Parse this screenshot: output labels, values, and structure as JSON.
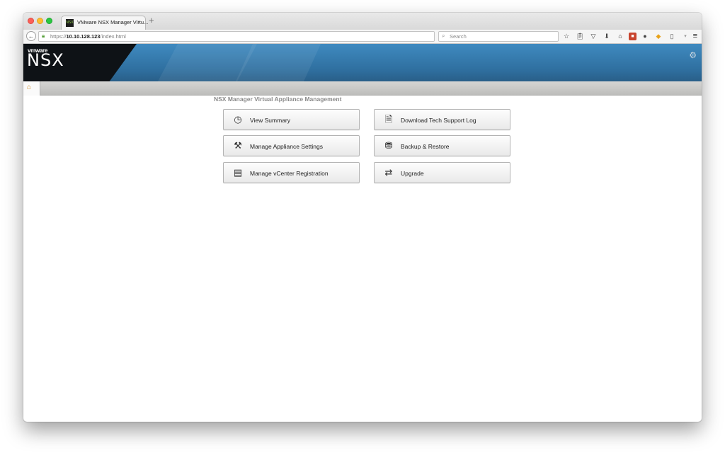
{
  "browser": {
    "tab": {
      "favicon": "NSX",
      "title": "VMware NSX Manager Virtu...",
      "close": "×"
    },
    "new_tab": "+",
    "url": {
      "prefix": "https://",
      "host": "10.10.128.123",
      "path": "/index.html"
    },
    "search_placeholder": "Search",
    "toolbar_icons": [
      "star-icon",
      "reading-list-icon",
      "pocket-icon",
      "download-icon",
      "home-icon",
      "extension-red-icon",
      "chat-icon",
      "colorful-extension-icon",
      "trash-icon",
      "dropdown-icon"
    ]
  },
  "banner": {
    "vendor": "vmware",
    "product": "NSX"
  },
  "content": {
    "title": "NSX Manager Virtual Appliance Management",
    "buttons": [
      {
        "label": "View Summary",
        "icon": "dashboard-icon"
      },
      {
        "label": "Download Tech Support Log",
        "icon": "document-download-icon"
      },
      {
        "label": "Manage Appliance Settings",
        "icon": "tools-icon"
      },
      {
        "label": "Backup & Restore",
        "icon": "database-backup-icon"
      },
      {
        "label": "Manage vCenter Registration",
        "icon": "server-registration-icon"
      },
      {
        "label": "Upgrade",
        "icon": "swap-arrows-icon"
      }
    ]
  },
  "colors": {
    "banner_blue": "#3f8ac0",
    "banner_dark": "#0e1216",
    "subbar_gray": "#c9c9c7",
    "title_gray": "#8a8a8a"
  }
}
